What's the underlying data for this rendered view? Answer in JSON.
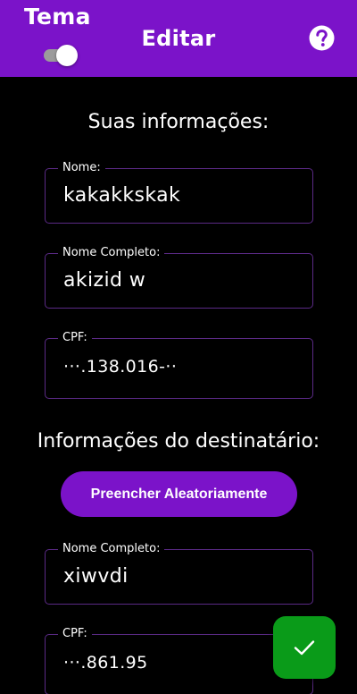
{
  "appbar": {
    "theme_label": "Tema",
    "theme_toggle_on": true,
    "title": "Editar",
    "help_icon": "help-circle-icon"
  },
  "user_section": {
    "title": "Suas informações:",
    "fields": [
      {
        "label": "Nome:",
        "value": "kakakkskak"
      },
      {
        "label": "Nome Completo:",
        "value": "akizid w"
      },
      {
        "label": "CPF:",
        "value": "···.138.016-··"
      }
    ]
  },
  "recipient_section": {
    "title": "Informações do destinatário:",
    "random_button_label": "Preencher Aleatoriamente",
    "fields": [
      {
        "label": "Nome Completo:",
        "value": "xiwvdi"
      },
      {
        "label": "CPF:",
        "value": "···.861.95"
      }
    ]
  },
  "fab": {
    "icon": "check-icon"
  },
  "colors": {
    "primary": "#7b13c9",
    "background": "#000000",
    "field_border": "#5b2a86",
    "fab": "#0a9b19"
  }
}
